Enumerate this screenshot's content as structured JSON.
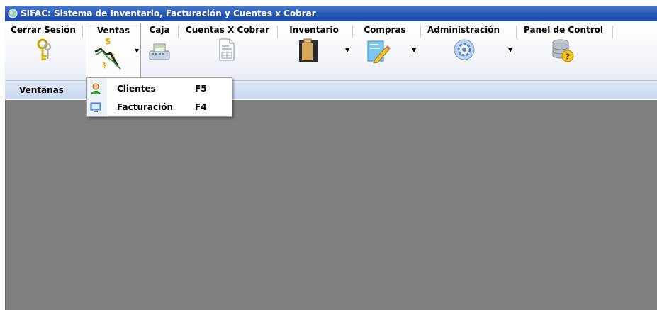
{
  "window": {
    "title": "SIFAC: Sistema de Inventario, Facturación y Cuentas x Cobrar"
  },
  "ribbon": {
    "buttons": [
      {
        "label": "Cerrar Sesión",
        "icon": "keys-icon",
        "has_dropdown": false
      },
      {
        "label": "Ventas",
        "icon": "sales-trend-icon",
        "has_dropdown": true,
        "active": true
      },
      {
        "label": "Caja",
        "icon": "cash-register-icon",
        "has_dropdown": false
      },
      {
        "label": "Cuentas X Cobrar",
        "icon": "invoice-document-icon",
        "has_dropdown": false
      },
      {
        "label": "Inventario",
        "icon": "clipboard-icon",
        "has_dropdown": true
      },
      {
        "label": "Compras",
        "icon": "edit-document-icon",
        "has_dropdown": true
      },
      {
        "label": "Administración",
        "icon": "gear-icon",
        "has_dropdown": true
      },
      {
        "label": "Panel de Control",
        "icon": "database-help-icon",
        "has_dropdown": false
      }
    ]
  },
  "windows_bar": {
    "label": "Ventanas"
  },
  "ventas_menu": {
    "items": [
      {
        "label": "Clientes",
        "shortcut": "F5",
        "icon": "client-user-icon"
      },
      {
        "label": "Facturación",
        "shortcut": "F4",
        "icon": "billing-monitor-icon"
      }
    ]
  },
  "colors": {
    "titlebar": "#2a5ab8",
    "workspace": "#808080",
    "windows_bar": "#c9d8ee"
  }
}
